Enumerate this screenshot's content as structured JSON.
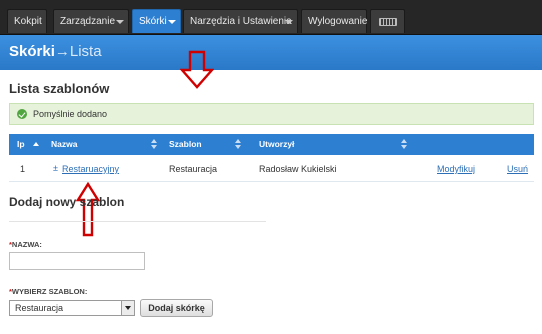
{
  "nav": {
    "items": [
      {
        "label": "Kokpit",
        "dropdown": false,
        "active": false
      },
      {
        "label": "Zarządzanie",
        "dropdown": true,
        "active": false
      },
      {
        "label": "Skórki",
        "dropdown": true,
        "active": true
      },
      {
        "label": "Narzędzia i Ustawienia",
        "dropdown": true,
        "active": false
      },
      {
        "label": "Wylogowanie",
        "dropdown": false,
        "active": false
      }
    ],
    "keyboard_icon": "keyboard-icon"
  },
  "header": {
    "section": "Skórki",
    "separator": "→",
    "page": "Lista"
  },
  "list": {
    "title": "Lista szablonów",
    "alert": "Pomyślnie dodano",
    "columns": [
      "Ip",
      "Nazwa",
      "Szablon",
      "Utworzył"
    ],
    "rows": [
      {
        "ip": "1",
        "plus": "±",
        "name": "Restaruacyjny",
        "template": "Restauracja",
        "created_by": "Radosław Kukielski",
        "modify": "Modyfikuj",
        "delete": "Usuń"
      }
    ]
  },
  "form": {
    "title": "Dodaj nowy szablon",
    "name_label": "NAZWA:",
    "name_value": "",
    "template_label": "WYBIERZ SZABLON:",
    "template_selected": "Restauracja",
    "submit": "Dodaj skórkę",
    "required_marker": "*"
  },
  "colors": {
    "accent": "#2d7fd2",
    "topbar": "#262626",
    "success_bg": "#e6f3da",
    "annotation_red": "#d10000"
  }
}
